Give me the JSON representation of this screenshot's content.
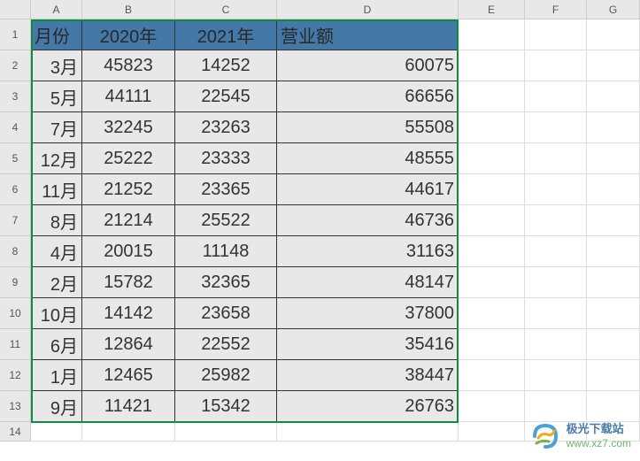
{
  "columns": [
    "A",
    "B",
    "C",
    "D",
    "E",
    "F",
    "G"
  ],
  "rowNumbers": [
    "1",
    "2",
    "3",
    "4",
    "5",
    "6",
    "7",
    "8",
    "9",
    "10",
    "11",
    "12",
    "13",
    "14"
  ],
  "headers": {
    "A": "月份",
    "B": "2020年",
    "C": "2021年",
    "D": "营业额"
  },
  "rows": [
    {
      "month": "3月",
      "y2020": "45823",
      "y2021": "14252",
      "total": "60075"
    },
    {
      "month": "5月",
      "y2020": "44111",
      "y2021": "22545",
      "total": "66656"
    },
    {
      "month": "7月",
      "y2020": "32245",
      "y2021": "23263",
      "total": "55508"
    },
    {
      "month": "12月",
      "y2020": "25222",
      "y2021": "23333",
      "total": "48555"
    },
    {
      "month": "11月",
      "y2020": "21252",
      "y2021": "23365",
      "total": "44617"
    },
    {
      "month": "8月",
      "y2020": "21214",
      "y2021": "25522",
      "total": "46736"
    },
    {
      "month": "4月",
      "y2020": "20015",
      "y2021": "11148",
      "total": "31163"
    },
    {
      "month": "2月",
      "y2020": "15782",
      "y2021": "32365",
      "total": "48147"
    },
    {
      "month": "10月",
      "y2020": "14142",
      "y2021": "23658",
      "total": "37800"
    },
    {
      "month": "6月",
      "y2020": "12864",
      "y2021": "22552",
      "total": "35416"
    },
    {
      "month": "1月",
      "y2020": "12465",
      "y2021": "25982",
      "total": "38447"
    },
    {
      "month": "9月",
      "y2020": "11421",
      "y2021": "15342",
      "total": "26763"
    }
  ],
  "watermark": {
    "title": "极光下载站",
    "url": "www.xz7.com"
  },
  "chart_data": {
    "type": "table",
    "title": "营业额",
    "columns": [
      "月份",
      "2020年",
      "2021年",
      "营业额"
    ],
    "data": [
      [
        "3月",
        45823,
        14252,
        60075
      ],
      [
        "5月",
        44111,
        22545,
        66656
      ],
      [
        "7月",
        32245,
        23263,
        55508
      ],
      [
        "12月",
        25222,
        23333,
        48555
      ],
      [
        "11月",
        21252,
        23365,
        44617
      ],
      [
        "8月",
        21214,
        25522,
        46736
      ],
      [
        "4月",
        20015,
        11148,
        31163
      ],
      [
        "2月",
        15782,
        32365,
        48147
      ],
      [
        "10月",
        14142,
        23658,
        37800
      ],
      [
        "6月",
        12864,
        22552,
        35416
      ],
      [
        "1月",
        12465,
        25982,
        38447
      ],
      [
        "9月",
        11421,
        15342,
        26763
      ]
    ]
  }
}
